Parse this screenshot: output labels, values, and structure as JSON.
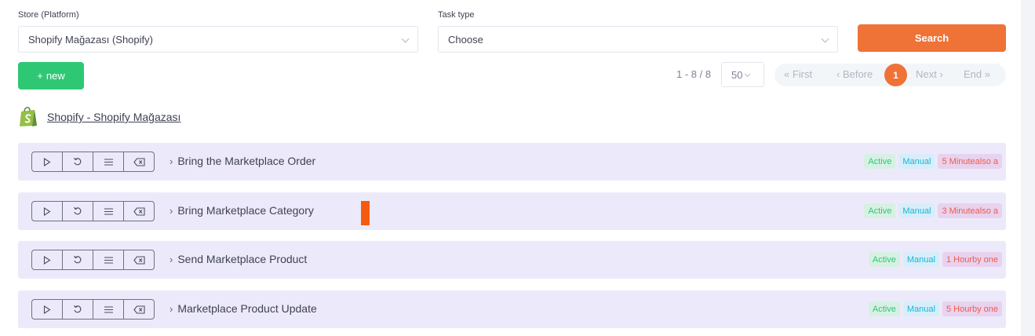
{
  "filters": {
    "store_label": "Store (Platform)",
    "store_value": "Shopify Mağazası (Shopify)",
    "task_type_label": "Task type",
    "task_type_value": "Choose",
    "search_label": "Search"
  },
  "toolbar": {
    "new_label": "new",
    "count_text": "1 - 8 / 8",
    "per_page": "50"
  },
  "pagination": {
    "first": "« First",
    "before": "‹ Before",
    "current": "1",
    "next": "Next ›",
    "end": "End »"
  },
  "store": {
    "link_text": "Shopify - Shopify Mağazası",
    "icon": "shopify-bag-icon",
    "brand_color": "#95bf47"
  },
  "colors": {
    "accent": "#ef7237",
    "success": "#2ec874",
    "row_bg": "#eceafa"
  },
  "row_actions": [
    "play-icon",
    "refresh-icon",
    "menu-icon",
    "clear-icon"
  ],
  "tasks": [
    {
      "name": "Bring the Marketplace Order",
      "status": "Active",
      "mode": "Manual",
      "schedule": "5 Minutealso a"
    },
    {
      "name": "Bring Marketplace Category",
      "status": "Active",
      "mode": "Manual",
      "schedule": "3 Minutealso a"
    },
    {
      "name": "Send Marketplace Product",
      "status": "Active",
      "mode": "Manual",
      "schedule": "1 Hourby one"
    },
    {
      "name": "Marketplace Product Update",
      "status": "Active",
      "mode": "Manual",
      "schedule": "5 Hourby one"
    }
  ]
}
